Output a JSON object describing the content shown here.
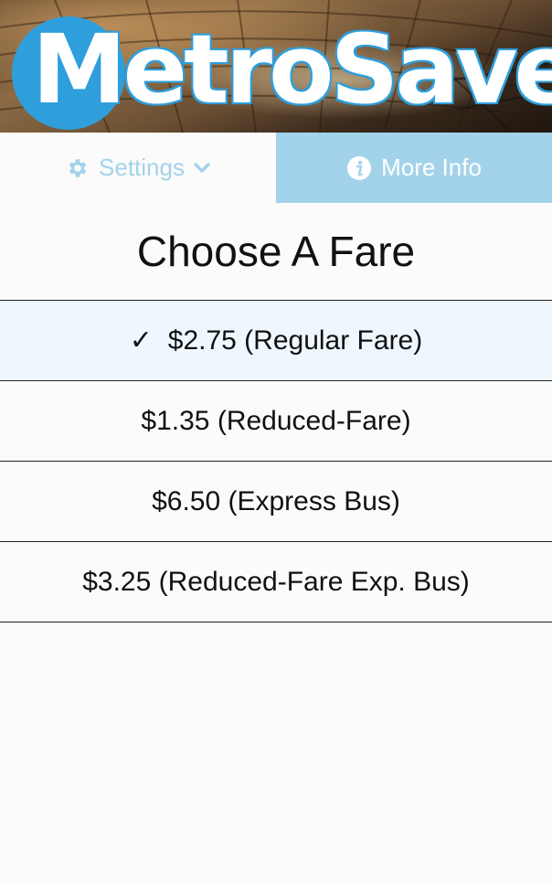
{
  "app": {
    "logo_text": "MetroSaver"
  },
  "colors": {
    "brand_blue": "#2f9fdc",
    "tab_light_blue": "#a3d3ea",
    "selected_row": "#eef7fe"
  },
  "tabs": {
    "settings": {
      "label": "Settings",
      "icon": "gear-icon",
      "chevron": "chevron-down-icon"
    },
    "more_info": {
      "label": "More Info",
      "icon": "info-icon"
    }
  },
  "main": {
    "title": "Choose A Fare",
    "fares": [
      {
        "label": "$2.75 (Regular Fare)",
        "selected": true,
        "check": "✓"
      },
      {
        "label": "$1.35 (Reduced-Fare)",
        "selected": false
      },
      {
        "label": "$6.50 (Express Bus)",
        "selected": false
      },
      {
        "label": "$3.25 (Reduced-Fare Exp. Bus)",
        "selected": false
      }
    ]
  }
}
